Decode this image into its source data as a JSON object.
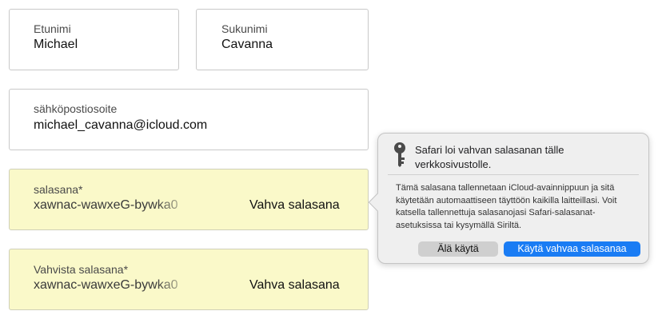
{
  "form": {
    "first_name": {
      "label": "Etunimi",
      "value": "Michael"
    },
    "last_name": {
      "label": "Sukunimi",
      "value": "Cavanna"
    },
    "email": {
      "label": "sähköpostiosoite",
      "value": "michael_cavanna@icloud.com"
    },
    "password": {
      "label": "salasana*",
      "value": "xawnac-wawxeG-bywka0",
      "strength": "Vahva salasana"
    },
    "confirm_password": {
      "label": "Vahvista salasana*",
      "value": "xawnac-wawxeG-bywka0",
      "strength": "Vahva salasana"
    }
  },
  "popover": {
    "icon": "key-icon",
    "title": "Safari loi vahvan salasanan tälle verkkosivustolle.",
    "body": "Tämä salasana tallennetaan iCloud-avainnippuun ja sitä käytetään automaattiseen täyttöön kaikilla laitteillasi. Voit katsella tallennettuja salasanojasi Safari-salasanat-asetuksissa tai kysymällä Siriltä.",
    "dont_use_label": "Älä käytä",
    "use_label": "Käytä vahvaa salasanaa"
  },
  "colors": {
    "autofill_background": "#faf9c9",
    "primary_button": "#1a7cf4",
    "popover_background": "#efefef"
  }
}
